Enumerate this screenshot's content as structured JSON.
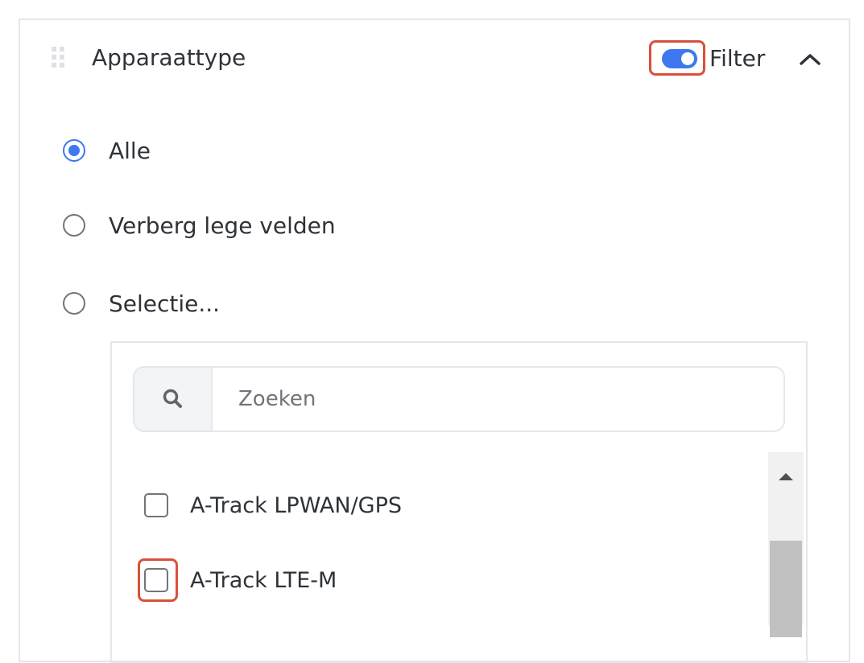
{
  "header": {
    "title": "Apparaattype",
    "filter_label": "Filter",
    "filter_enabled": true
  },
  "radio_options": [
    {
      "label": "Alle",
      "checked": true
    },
    {
      "label": "Verberg lege velden",
      "checked": false
    },
    {
      "label": "Selectie...",
      "checked": false
    }
  ],
  "search": {
    "placeholder": "Zoeken",
    "value": ""
  },
  "device_list": [
    {
      "label": "A-Track LPWAN/GPS",
      "checked": false
    },
    {
      "label": "A-Track LTE-M",
      "checked": false
    }
  ],
  "colors": {
    "accent": "#3d78f0",
    "highlight": "#d9503b",
    "text": "#2f3338",
    "border": "#e4e7eb"
  },
  "icons": {
    "drag": "drag-handle-icon",
    "collapse": "chevron-up-icon",
    "search": "search-icon",
    "scroll_up": "arrow-up-icon"
  }
}
